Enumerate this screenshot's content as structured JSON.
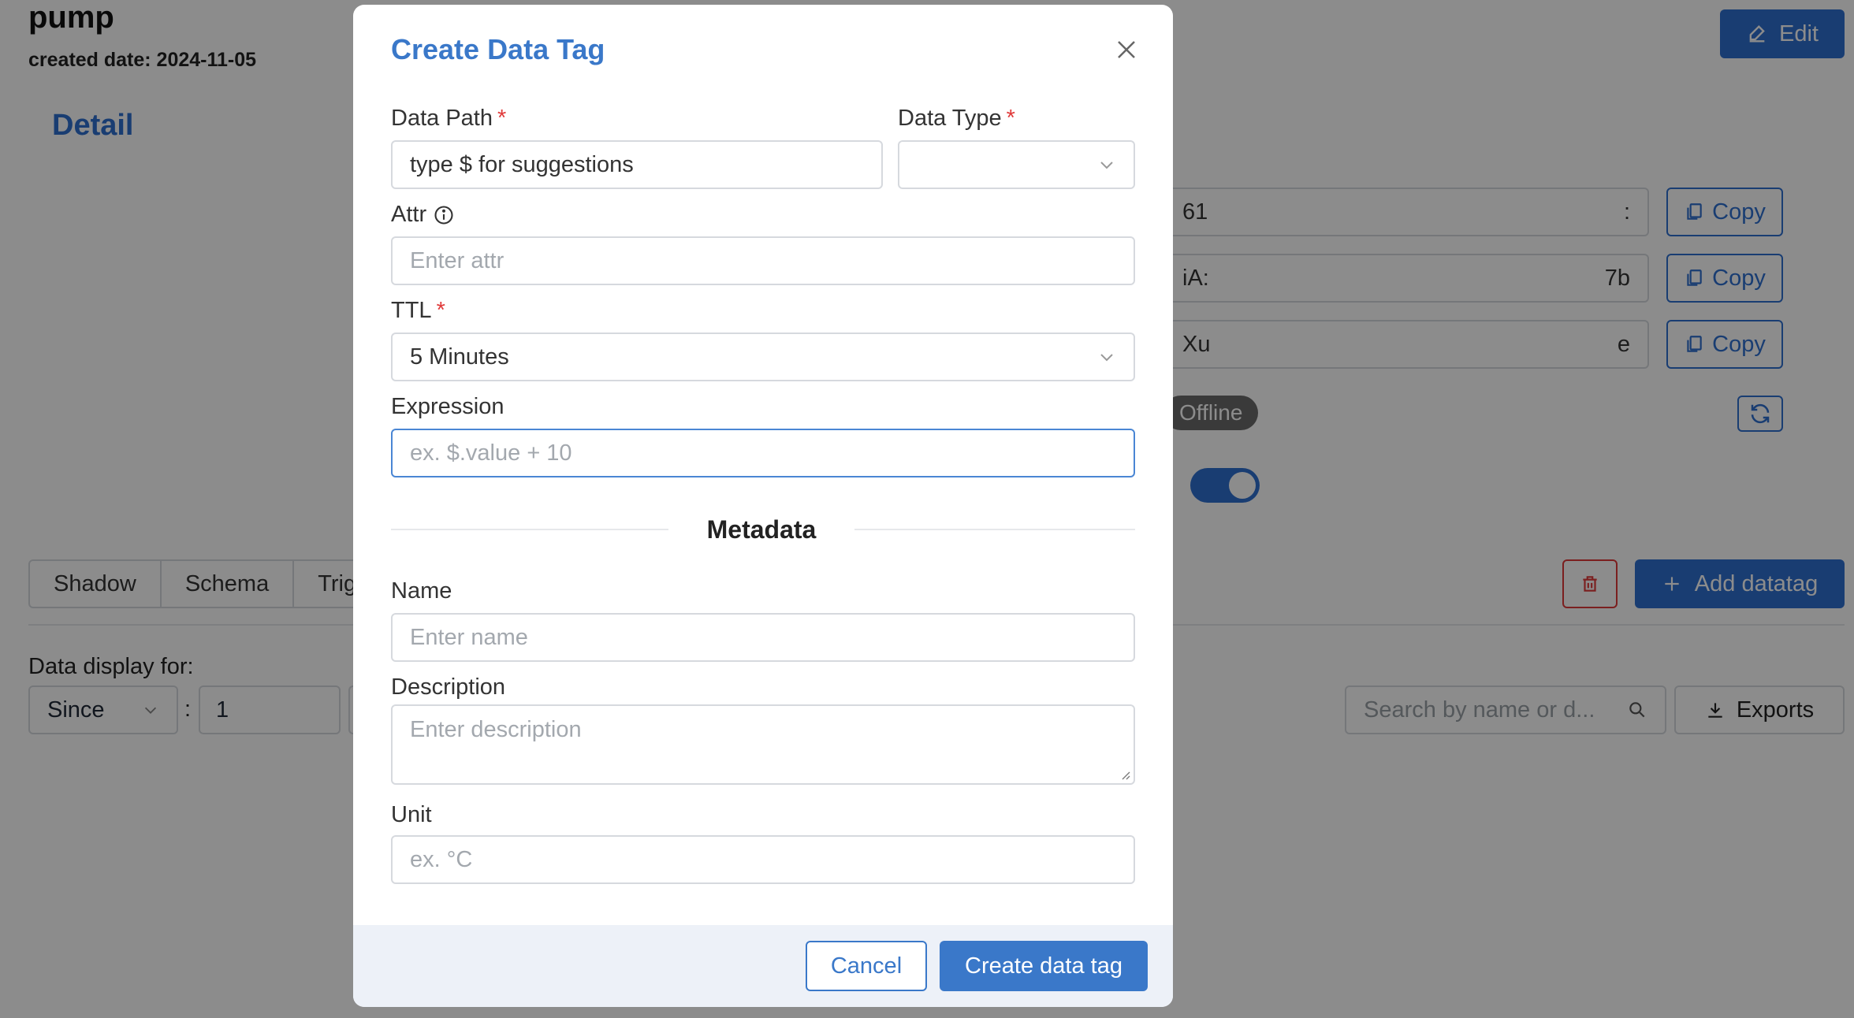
{
  "page": {
    "title": "pump",
    "created_date": "created date: 2024-11-05",
    "edit_label": "Edit",
    "detail_title": "Detail",
    "fields": [
      {
        "value_left": "61",
        "value_right": ":"
      },
      {
        "value_left": "iA:",
        "value_right": "7b"
      },
      {
        "value_left": "Xu",
        "value_right": "e"
      }
    ],
    "copy_label": "Copy",
    "status": "Offline",
    "tabs": [
      "Shadow",
      "Schema",
      "Trig"
    ],
    "add_datatag_label": "Add datatag",
    "display_label": "Data display for:",
    "since_value": "Since",
    "since_number": "1",
    "colon": ":",
    "search_placeholder": "Search by name or d...",
    "exports_label": "Exports"
  },
  "modal": {
    "title": "Create Data Tag",
    "data_path_label": "Data Path",
    "data_path_placeholder": "type $ for suggestions",
    "data_type_label": "Data Type",
    "attr_label": "Attr",
    "attr_placeholder": "Enter attr",
    "ttl_label": "TTL",
    "ttl_value": "5 Minutes",
    "expression_label": "Expression",
    "expression_placeholder": "ex. $.value + 10",
    "metadata_title": "Metadata",
    "name_label": "Name",
    "name_placeholder": "Enter name",
    "description_label": "Description",
    "description_placeholder": "Enter description",
    "unit_label": "Unit",
    "unit_placeholder": "ex. °C",
    "required_mark": "*",
    "cancel_label": "Cancel",
    "create_label": "Create data tag"
  },
  "colors": {
    "accent": "#3a78c9",
    "primary_button": "#2f6fd0",
    "required": "#e03a3a",
    "overlay": "rgba(0,0,0,0.45)"
  }
}
